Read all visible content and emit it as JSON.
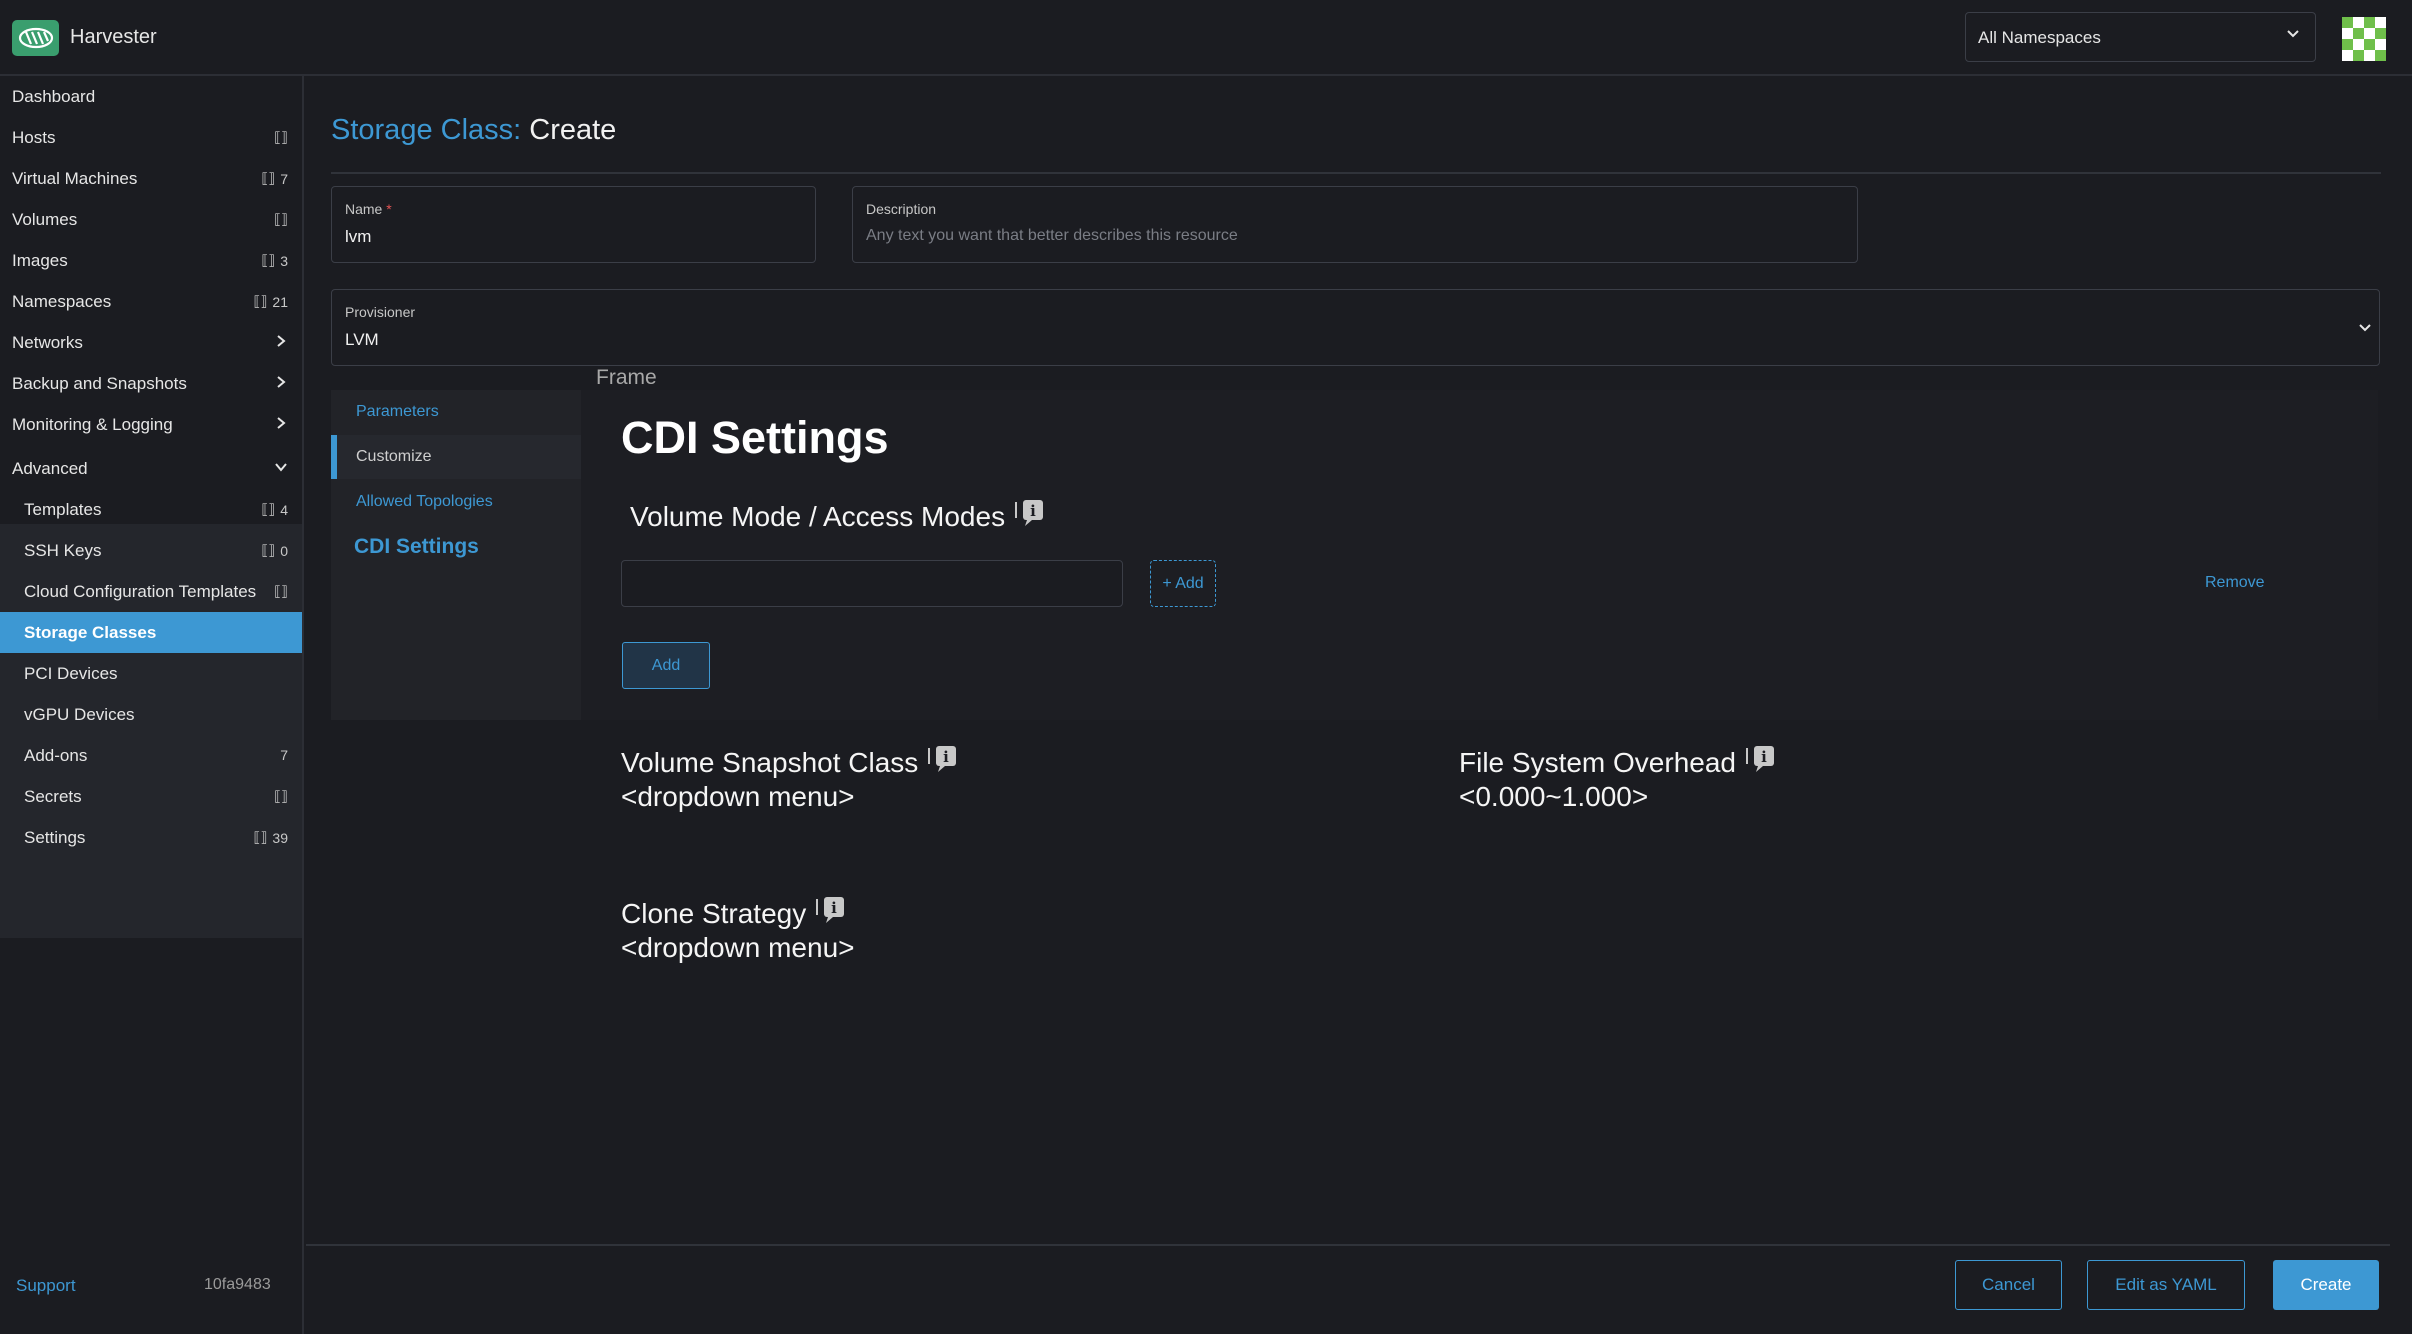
{
  "app": {
    "name": "Harvester",
    "logo_icon": "harvester-logo-icon"
  },
  "header": {
    "namespace_select": "All Namespaces"
  },
  "sidebar": {
    "items": [
      {
        "label": "Dashboard",
        "count": ""
      },
      {
        "label": "Hosts",
        "count": ""
      },
      {
        "label": "Virtual Machines",
        "count": "7"
      },
      {
        "label": "Volumes",
        "count": ""
      },
      {
        "label": "Images",
        "count": "3"
      },
      {
        "label": "Namespaces",
        "count": "21"
      },
      {
        "label": "Networks",
        "count": ""
      },
      {
        "label": "Backup and Snapshots",
        "count": ""
      },
      {
        "label": "Monitoring & Logging",
        "count": ""
      },
      {
        "label": "Advanced",
        "count": ""
      },
      {
        "label": "Templates",
        "count": "4"
      },
      {
        "label": "SSH Keys",
        "count": "0"
      },
      {
        "label": "Cloud Configuration Templates",
        "count": ""
      },
      {
        "label": "Storage Classes",
        "count": ""
      },
      {
        "label": "PCI Devices",
        "count": ""
      },
      {
        "label": "vGPU Devices",
        "count": ""
      },
      {
        "label": "Add-ons",
        "count": "7"
      },
      {
        "label": "Secrets",
        "count": ""
      },
      {
        "label": "Settings",
        "count": "39"
      }
    ],
    "support": "Support",
    "version": "10fa9483"
  },
  "page": {
    "title_prefix": "Storage Class:",
    "title_action": "Create",
    "name_label": "Name",
    "name_required_mark": "*",
    "name_value": "lvm",
    "description_label": "Description",
    "description_placeholder": "Any text you want that better describes this resource",
    "provisioner_label": "Provisioner",
    "provisioner_value": "LVM"
  },
  "frame_label": "Frame",
  "tabs": [
    "Parameters",
    "Customize",
    "Allowed Topologies",
    "CDI Settings"
  ],
  "cdi": {
    "heading": "CDI Settings",
    "volume_mode_label": "Volume Mode / Access Modes",
    "add_inline": "+ Add",
    "remove": "Remove",
    "add_button": "Add",
    "snapshot_class_label": "Volume Snapshot Class",
    "snapshot_class_value": "<dropdown menu>",
    "fs_overhead_label": "File System Overhead",
    "fs_overhead_value": "<0.000~1.000>",
    "clone_strategy_label": "Clone Strategy",
    "clone_strategy_value": "<dropdown menu>"
  },
  "footer": {
    "cancel": "Cancel",
    "edit_yaml": "Edit as YAML",
    "create": "Create"
  },
  "colors": {
    "accent": "#3d98d3",
    "background": "#1b1c21",
    "logo": "#3a9e6e"
  }
}
